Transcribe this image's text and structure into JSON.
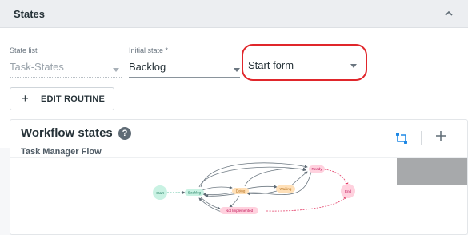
{
  "section": {
    "title": "States"
  },
  "fields": {
    "state_list": {
      "label": "State list",
      "value": "Task-States"
    },
    "initial_state": {
      "label": "Initial state *",
      "value": "Backlog"
    },
    "start_form": {
      "placeholder": "Start form"
    }
  },
  "edit_routine": {
    "label": "EDIT ROUTINE"
  },
  "workflow": {
    "title": "Workflow states",
    "help": "?",
    "subtitle": "Task Manager Flow",
    "nodes": {
      "start": "Start",
      "backlog": "Backlog",
      "doing": "Doing",
      "waiting": "Waiting",
      "ready": "Ready",
      "end": "End",
      "not_implemented": "Not Implemented"
    }
  },
  "colors": {
    "highlight": "#e0262b",
    "accent": "#1e88e5",
    "start_node": "#c9f2e3",
    "backlog_node": "#c9f2e3",
    "doing_node": "#ffe0b8",
    "waiting_node": "#ffe0b8",
    "ready_node": "#ffd1de",
    "end_node": "#ffd1de",
    "not_implemented_node": "#ffd1de",
    "error_edge": "#e4406a"
  },
  "icons": {
    "collapse": "chevron-up-icon",
    "help": "help-icon",
    "flow": "flow-layout-icon",
    "add": "plus-icon",
    "edit_plus": "plus-icon"
  }
}
